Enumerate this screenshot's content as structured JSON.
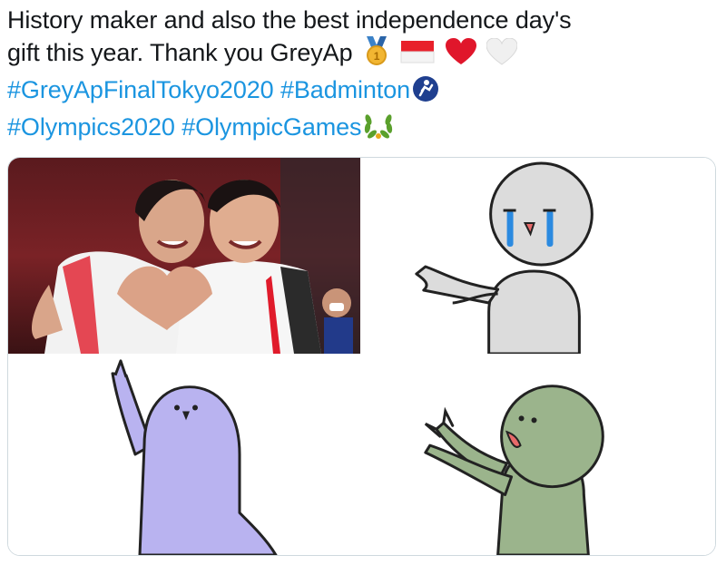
{
  "tweet": {
    "line1": "History maker and also the best independence day's",
    "line2": "gift this year. Thank you GreyAp",
    "hashtag1": "#GreyApFinalTokyo2020",
    "hashtag2": "#Badminton",
    "hashtag3": "#Olympics2020",
    "hashtag4": "#OlympicGames",
    "emojis_line2": [
      "gold-medal-icon",
      "indonesia-flag-icon",
      "red-heart-icon",
      "white-heart-icon"
    ],
    "emoji_line3": "badminton-icon",
    "emoji_line4": "laurel-wreath-icon"
  },
  "media": {
    "images": [
      {
        "name": "photo-players-heart-hands"
      },
      {
        "name": "sticker-crying-grey-character"
      },
      {
        "name": "sticker-purple-character-pointing-up"
      },
      {
        "name": "sticker-green-character-reaching"
      }
    ]
  },
  "colors": {
    "text": "#14171a",
    "hashtag": "#1b95e0",
    "border": "#cfd9de",
    "grey_char": "#d9d9d9",
    "purple_char": "#b9b3f0",
    "green_char": "#9bb48c",
    "tears": "#2b8ae0"
  }
}
